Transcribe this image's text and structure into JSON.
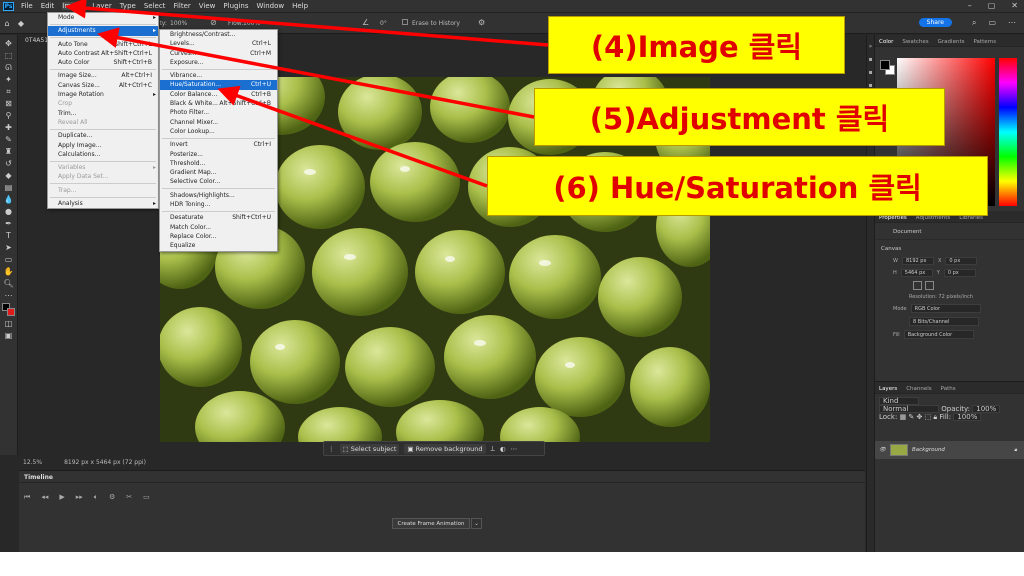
{
  "menubar": {
    "items": [
      "File",
      "Edit",
      "Image",
      "Layer",
      "Type",
      "Select",
      "Filter",
      "View",
      "Plugins",
      "Window",
      "Help"
    ]
  },
  "optionsbar": {
    "opacity_label": "pacity:",
    "opacity_value": "100%",
    "flow_label": "Flow:",
    "flow_value": "100%",
    "angle_value": "0°",
    "erase_history": "Erase to History",
    "share": "Share"
  },
  "document_tab": "0T4A51",
  "image_menu": {
    "items": [
      {
        "label": "Mode",
        "shortcut": "",
        "sub": true,
        "disabled": false
      },
      {
        "sep": true
      },
      {
        "label": "Adjustments",
        "shortcut": "",
        "sub": true,
        "highlight": true
      },
      {
        "sep": true
      },
      {
        "label": "Auto Tone",
        "shortcut": "Shift+Ctrl+L"
      },
      {
        "label": "Auto Contrast",
        "shortcut": "Alt+Shift+Ctrl+L"
      },
      {
        "label": "Auto Color",
        "shortcut": "Shift+Ctrl+B"
      },
      {
        "sep": true
      },
      {
        "label": "Image Size...",
        "shortcut": "Alt+Ctrl+I"
      },
      {
        "label": "Canvas Size...",
        "shortcut": "Alt+Ctrl+C"
      },
      {
        "label": "Image Rotation",
        "shortcut": "",
        "sub": true
      },
      {
        "label": "Crop",
        "shortcut": "",
        "disabled": true
      },
      {
        "label": "Trim...",
        "shortcut": ""
      },
      {
        "label": "Reveal All",
        "shortcut": "",
        "disabled": true
      },
      {
        "sep": true
      },
      {
        "label": "Duplicate...",
        "shortcut": ""
      },
      {
        "label": "Apply Image...",
        "shortcut": ""
      },
      {
        "label": "Calculations...",
        "shortcut": ""
      },
      {
        "sep": true
      },
      {
        "label": "Variables",
        "shortcut": "",
        "sub": true,
        "disabled": true
      },
      {
        "label": "Apply Data Set...",
        "shortcut": "",
        "disabled": true
      },
      {
        "sep": true
      },
      {
        "label": "Trap...",
        "shortcut": "",
        "disabled": true
      },
      {
        "sep": true
      },
      {
        "label": "Analysis",
        "shortcut": "",
        "sub": true
      }
    ]
  },
  "adjust_menu": {
    "items": [
      {
        "label": "Brightness/Contrast...",
        "shortcut": ""
      },
      {
        "label": "Levels...",
        "shortcut": "Ctrl+L"
      },
      {
        "label": "Curves...",
        "shortcut": "Ctrl+M"
      },
      {
        "label": "Exposure...",
        "shortcut": ""
      },
      {
        "sep": true
      },
      {
        "label": "Vibrance...",
        "shortcut": ""
      },
      {
        "label": "Hue/Saturation...",
        "shortcut": "Ctrl+U",
        "highlight": true
      },
      {
        "label": "Color Balance...",
        "shortcut": "Ctrl+B"
      },
      {
        "label": "Black & White...",
        "shortcut": "Alt+Shift+Ctrl+B"
      },
      {
        "label": "Photo Filter...",
        "shortcut": ""
      },
      {
        "label": "Channel Mixer...",
        "shortcut": ""
      },
      {
        "label": "Color Lookup...",
        "shortcut": ""
      },
      {
        "sep": true
      },
      {
        "label": "Invert",
        "shortcut": "Ctrl+I"
      },
      {
        "label": "Posterize...",
        "shortcut": ""
      },
      {
        "label": "Threshold...",
        "shortcut": ""
      },
      {
        "label": "Gradient Map...",
        "shortcut": ""
      },
      {
        "label": "Selective Color...",
        "shortcut": ""
      },
      {
        "sep": true
      },
      {
        "label": "Shadows/Highlights...",
        "shortcut": ""
      },
      {
        "label": "HDR Toning...",
        "shortcut": ""
      },
      {
        "sep": true
      },
      {
        "label": "Desaturate",
        "shortcut": "Shift+Ctrl+U"
      },
      {
        "label": "Match Color...",
        "shortcut": ""
      },
      {
        "label": "Replace Color...",
        "shortcut": ""
      },
      {
        "label": "Equalize",
        "shortcut": ""
      }
    ]
  },
  "callouts": {
    "c4": "(4)Image 클릭",
    "c5": "(5)Adjustment 클릭",
    "c6": "(6) Hue/Saturation 클릭",
    "color": "#ff0000",
    "bg": "#ffff00"
  },
  "context_bar": {
    "select_subject": "Select subject",
    "remove_background": "Remove background"
  },
  "status": {
    "zoom": "12.5%",
    "dims": "8192 px x 5464 px (72 ppi)"
  },
  "timeline": {
    "title": "Timeline",
    "create_button": "Create Frame Animation"
  },
  "color_panel": {
    "tabs": [
      "Color",
      "Swatches",
      "Gradients",
      "Patterns"
    ]
  },
  "properties": {
    "tabs": [
      "Properties",
      "Adjustments",
      "Libraries"
    ],
    "document": "Document",
    "canvas": "Canvas",
    "w_label": "W",
    "w_value": "8192 px",
    "x_label": "X",
    "x_value": "0 px",
    "h_label": "H",
    "h_value": "5464 px",
    "y_label": "Y",
    "y_value": "0 px",
    "resolution": "Resolution: 72 pixels/inch",
    "mode_label": "Mode",
    "mode_value": "RGB Color",
    "bits_value": "8 Bits/Channel",
    "fill_label": "Fill",
    "fill_value": "Background Color"
  },
  "layers": {
    "tabs": [
      "Layers",
      "Channels",
      "Paths"
    ],
    "kind": "Kind",
    "blend": "Normal",
    "opacity_label": "Opacity:",
    "opacity_value": "100%",
    "lock_label": "Lock:",
    "fill_label": "Fill:",
    "fill_value": "100%",
    "layer_name": "Background"
  }
}
